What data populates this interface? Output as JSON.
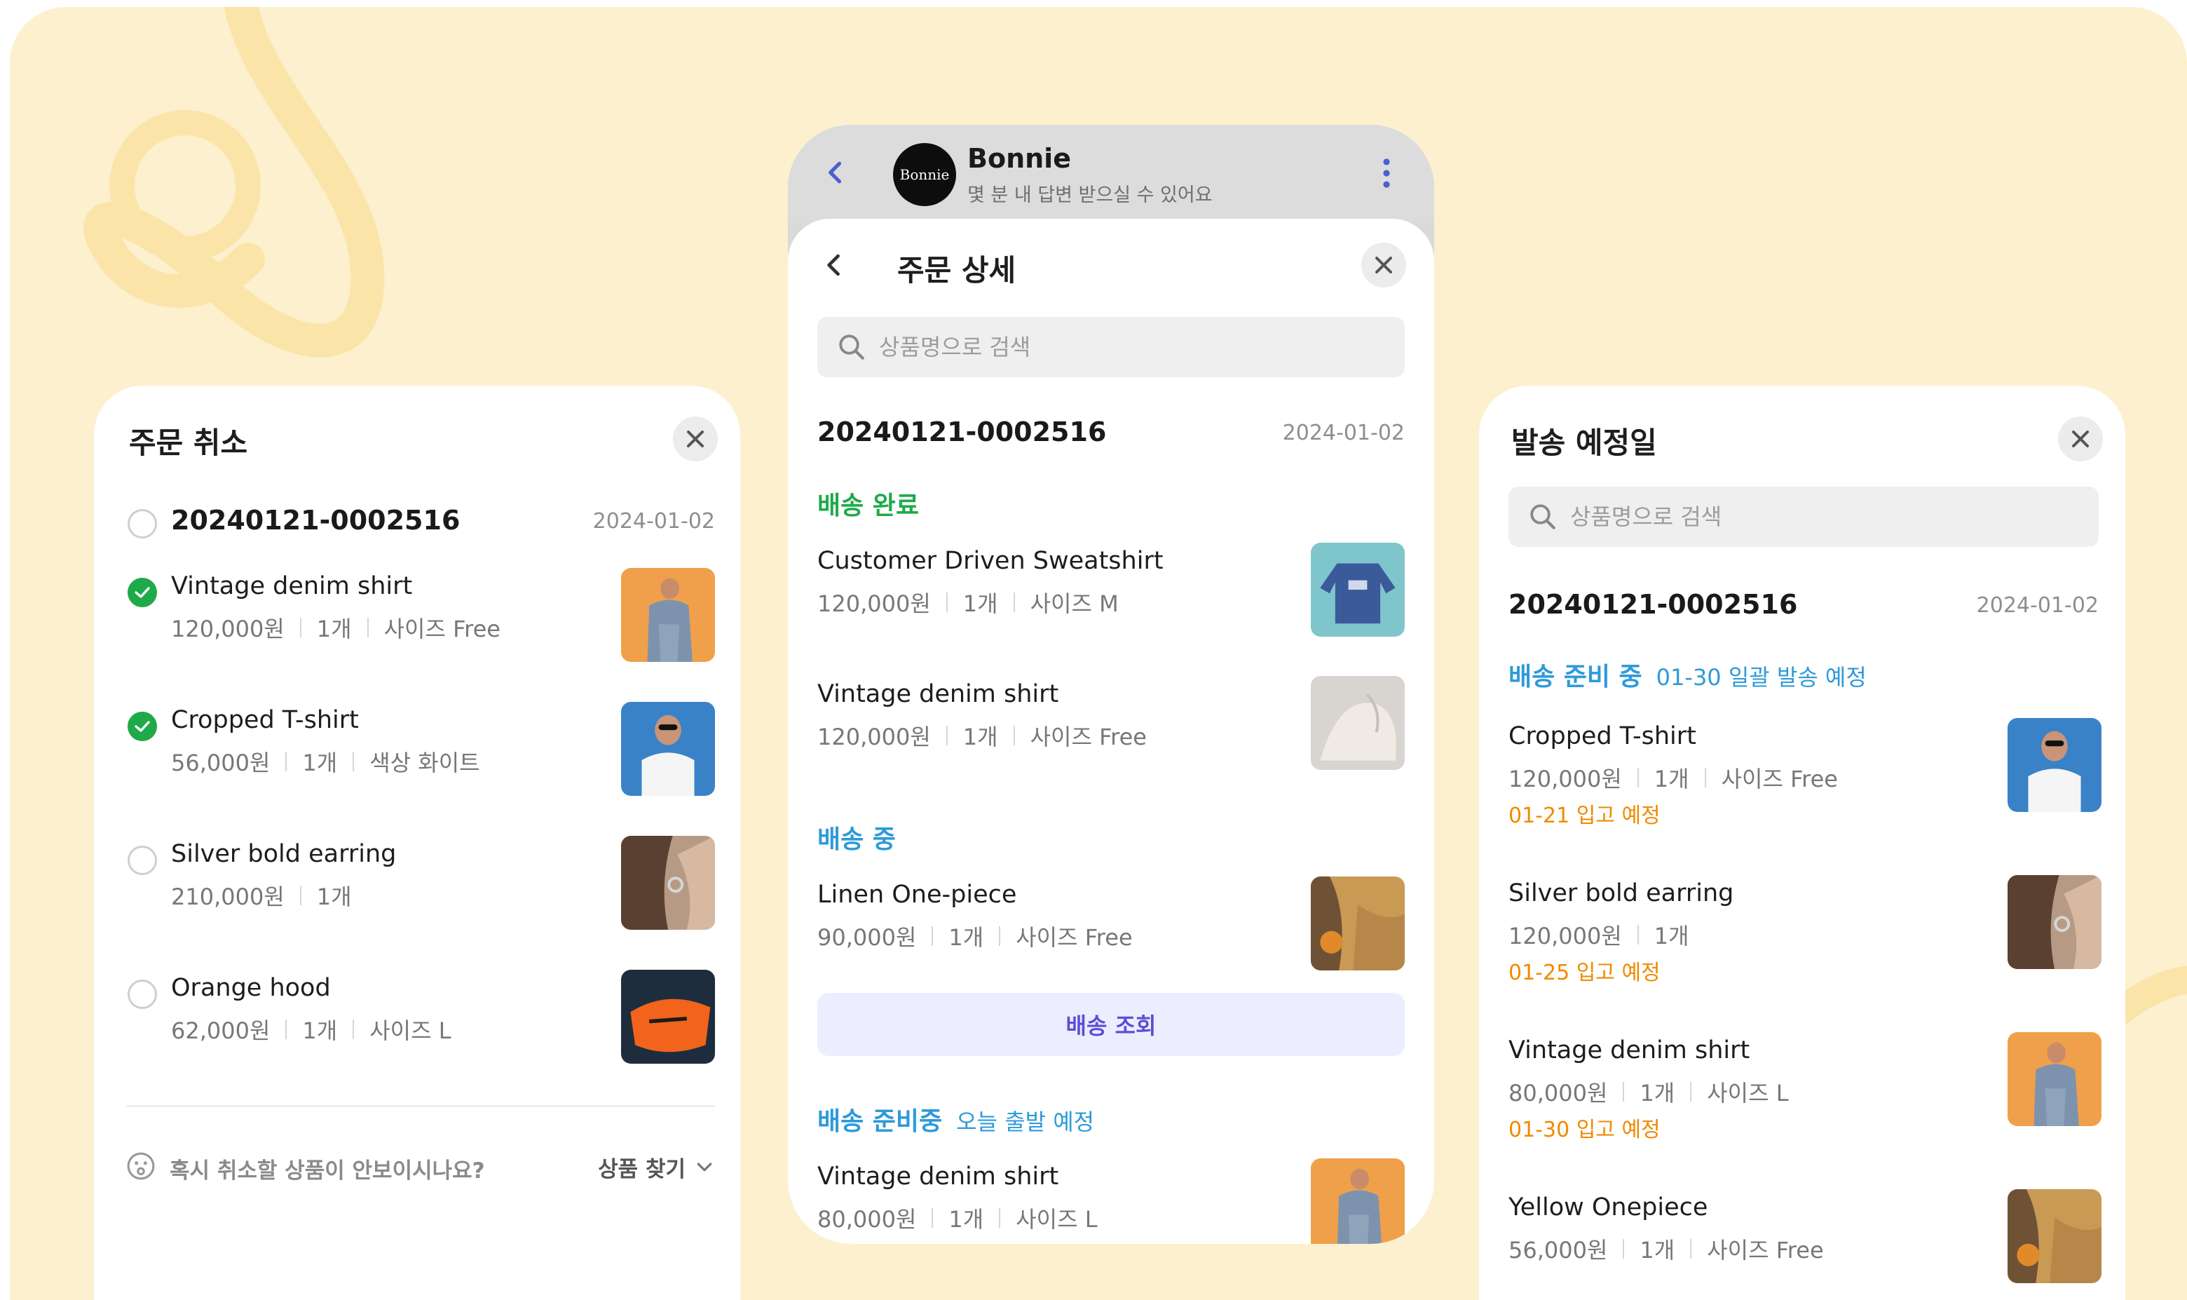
{
  "colors": {
    "background": "#fdf0cf",
    "accent_green": "#1faa4a",
    "accent_blue": "#2f9ad8",
    "accent_orange": "#f08a00",
    "accent_purple": "#5b4fd6"
  },
  "left_panel": {
    "title": "주문 취소",
    "order_number": "20240121-0002516",
    "order_date": "2024-01-02",
    "items": [
      {
        "name": "Vintage denim shirt",
        "price": "120,000원",
        "qty": "1개",
        "option": "사이즈 Free",
        "checked": true,
        "thumb": "denim-orange"
      },
      {
        "name": "Cropped T-shirt",
        "price": "56,000원",
        "qty": "1개",
        "option": "색상 화이트",
        "checked": true,
        "thumb": "tshirt-blue"
      },
      {
        "name": "Silver bold earring",
        "price": "210,000원",
        "qty": "1개",
        "option": "",
        "checked": false,
        "thumb": "earring-hair"
      },
      {
        "name": "Orange hood",
        "price": "62,000원",
        "qty": "1개",
        "option": "사이즈 L",
        "checked": false,
        "thumb": "hood-orange"
      }
    ],
    "footer_question": "혹시 취소할 상품이 안보이시나요?",
    "footer_link": "상품 찾기"
  },
  "center_panel": {
    "chat_header": {
      "avatar_text": "Bonnie",
      "name": "Bonnie",
      "subtitle": "몇 분 내 답변 받으실 수 있어요"
    },
    "title": "주문 상세",
    "search_placeholder": "상품명으로 검색",
    "order_number": "20240121-0002516",
    "order_date": "2024-01-02",
    "groups": [
      {
        "status": "배송 완료",
        "status_sub": "",
        "items": [
          {
            "name": "Customer Driven Sweatshirt",
            "price": "120,000원",
            "qty": "1개",
            "option": "사이즈 M",
            "thumb": "sweatshirt"
          },
          {
            "name": "Vintage denim shirt",
            "price": "120,000원",
            "qty": "1개",
            "option": "사이즈 Free",
            "thumb": "white-fabric"
          }
        ]
      },
      {
        "status": "배송 중",
        "status_sub": "",
        "items": [
          {
            "name": "Linen One-piece",
            "price": "90,000원",
            "qty": "1개",
            "option": "사이즈 Free",
            "thumb": "linen"
          }
        ],
        "button": "배송 조회"
      },
      {
        "status": "배송 준비중",
        "status_sub": "오늘 출발 예정",
        "items": [
          {
            "name": "Vintage denim shirt",
            "price": "80,000원",
            "qty": "1개",
            "option": "사이즈 L",
            "thumb": "denim-orange"
          }
        ]
      }
    ]
  },
  "right_panel": {
    "title": "발송 예정일",
    "search_placeholder": "상품명으로 검색",
    "order_number": "20240121-0002516",
    "order_date": "2024-01-02",
    "status": "배송 준비 중",
    "status_sub": "01-30 일괄 발송 예정",
    "items": [
      {
        "name": "Cropped T-shirt",
        "price": "120,000원",
        "qty": "1개",
        "option": "사이즈 Free",
        "note": "01-21 입고 예정",
        "thumb": "tshirt-blue"
      },
      {
        "name": "Silver bold earring",
        "price": "120,000원",
        "qty": "1개",
        "option": "",
        "note": "01-25 입고 예정",
        "thumb": "earring-hair"
      },
      {
        "name": "Vintage denim shirt",
        "price": "80,000원",
        "qty": "1개",
        "option": "사이즈 L",
        "note": "01-30 입고 예정",
        "thumb": "denim-orange"
      },
      {
        "name": "Yellow Onepiece",
        "price": "56,000원",
        "qty": "1개",
        "option": "사이즈 Free",
        "note": "",
        "thumb": "linen"
      }
    ]
  }
}
